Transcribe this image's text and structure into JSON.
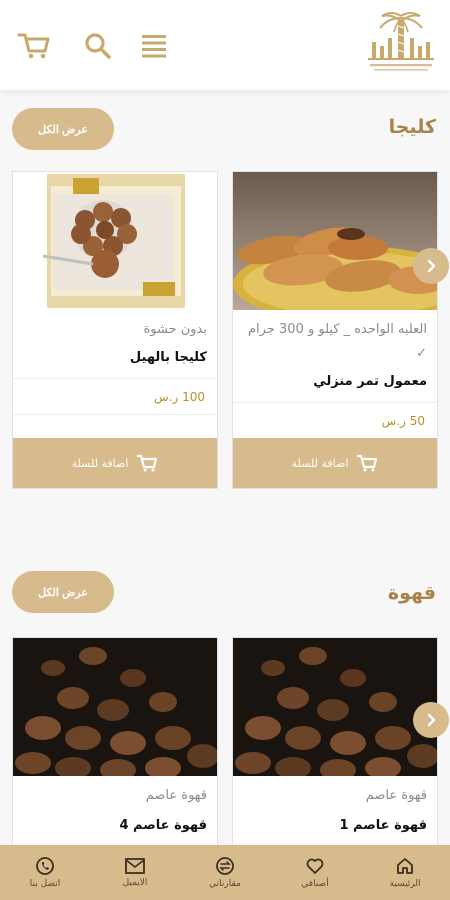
{
  "header": {
    "icons": [
      "cart-icon",
      "search-icon",
      "menu-icon"
    ],
    "logo_text": "بيت الأصالة للتمور"
  },
  "sections": [
    {
      "title": "كليجا",
      "view_all": "عرض الكل",
      "products": [
        {
          "description": "العلبه الواحده _ كيلو و 300 جرام ✓",
          "name": "معمول تمر منزلي",
          "price": "50 ر.س",
          "cart_label": "اضافة للسلة"
        },
        {
          "description": "بدون حشوة",
          "name": "كليجا بالهيل",
          "price": "100 ر.س",
          "cart_label": "اضافة للسلة"
        }
      ]
    },
    {
      "title": "قهوة",
      "view_all": "عرض الكل",
      "products": [
        {
          "description": "قهوة عاصم",
          "name": "قهوة عاصم 1"
        },
        {
          "description": "قهوة عاصم",
          "name": "قهوة عاصم 4"
        }
      ]
    }
  ],
  "bottom_nav": [
    {
      "label": "الرئيسية",
      "icon": "home-icon"
    },
    {
      "label": "أصنافي",
      "icon": "heart-icon"
    },
    {
      "label": "مقارناتي",
      "icon": "compare-icon"
    },
    {
      "label": "الايميل",
      "icon": "email-icon"
    },
    {
      "label": "اتصل بنا",
      "icon": "phone-icon"
    }
  ],
  "colors": {
    "accent": "#d8bb8c",
    "title": "#a9834a",
    "price": "#b8912a"
  }
}
